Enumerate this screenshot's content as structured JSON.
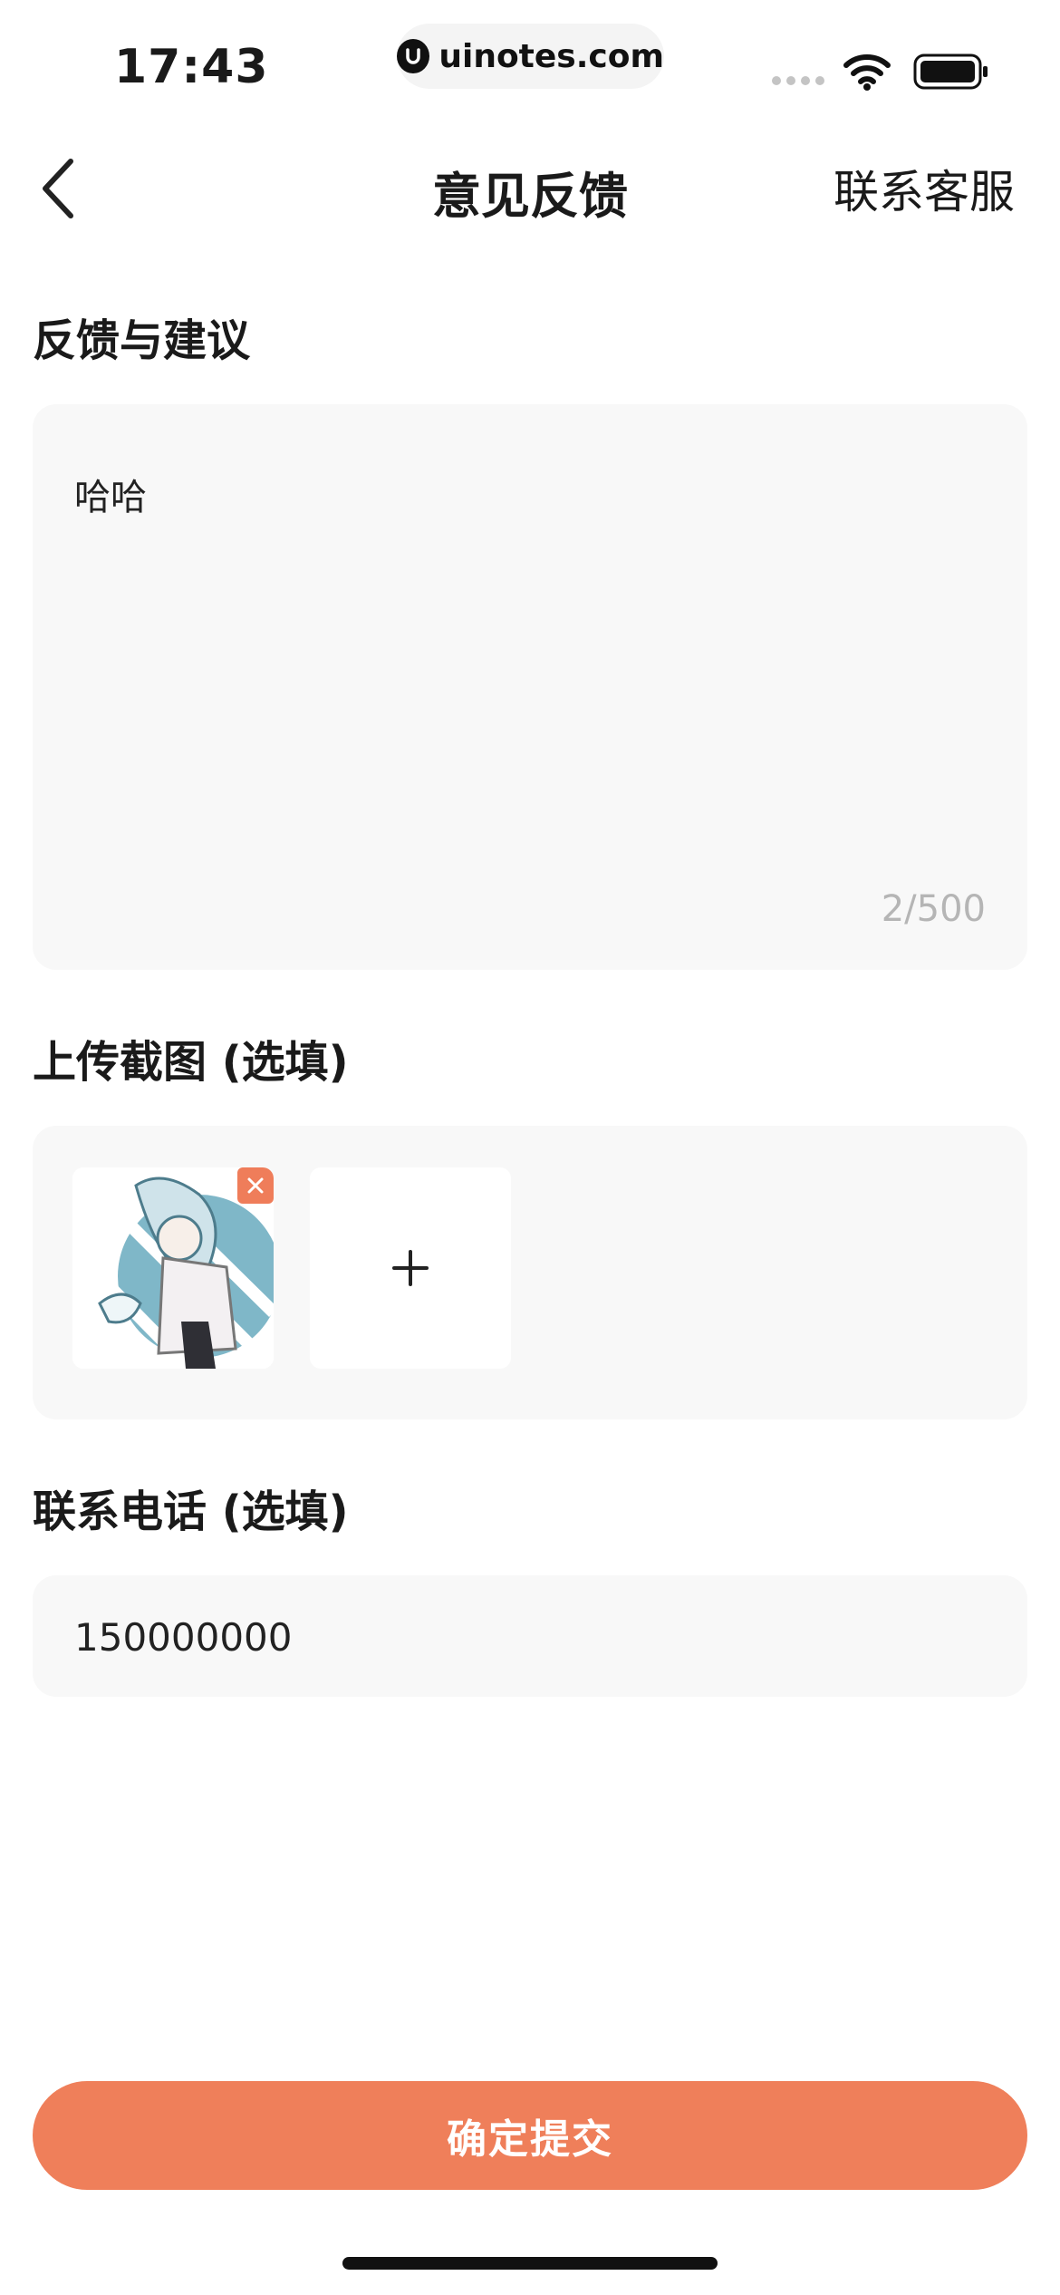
{
  "status_bar": {
    "time": "17:43",
    "url": "uinotes.com"
  },
  "nav": {
    "title": "意见反馈",
    "right_link": "联系客服",
    "back_icon": "chevron-left-icon"
  },
  "feedback": {
    "label": "反馈与建议",
    "value": "哈哈",
    "counter": "2/500"
  },
  "upload": {
    "label": "上传截图 (选填)",
    "add_icon": "plus-icon",
    "remove_icon": "close-icon"
  },
  "phone": {
    "label": "联系电话 (选填)",
    "value": "150000000"
  },
  "submit": {
    "label": "确定提交"
  },
  "colors": {
    "accent": "#ef7f5a",
    "card_bg": "#f8f8f8",
    "counter_text": "#b5b5b5"
  }
}
